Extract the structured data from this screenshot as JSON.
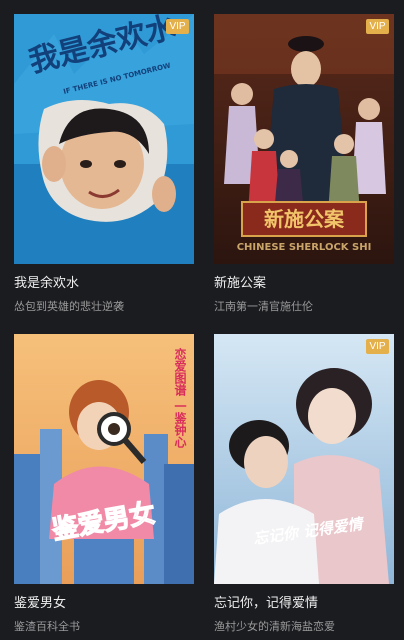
{
  "items": [
    {
      "title": "我是余欢水",
      "subtitle": "怂包到英雄的悲壮逆袭",
      "vip": "VIP",
      "poster_title": "我是余欢水",
      "poster_tagline": "IF THERE IS NO TOMORROW",
      "colors": {
        "bg": "#2f9ad6",
        "accent": "#12407a"
      }
    },
    {
      "title": "新施公案",
      "subtitle": "江南第一清官施仕伦",
      "vip": "VIP",
      "poster_title": "新施公案",
      "poster_tagline": "CHINESE SHERLOCK SHI",
      "colors": {
        "bg": "#4a2418",
        "accent": "#b02b1e"
      }
    },
    {
      "title": "鉴爱男女",
      "subtitle": "鉴渣百科全书",
      "vip": "",
      "poster_title": "鉴爱男女",
      "poster_tagline": "恋爱图谱 一鉴钟心",
      "colors": {
        "bg": "#f3b46a",
        "accent": "#e2336b"
      }
    },
    {
      "title": "忘记你，记得爱情",
      "subtitle": "渔村少女的清新海盐恋爱",
      "vip": "VIP",
      "poster_title": "忘记你 记得爱情",
      "poster_tagline": "",
      "colors": {
        "bg": "#a9cbe6",
        "accent": "#f3dfe4"
      }
    }
  ]
}
